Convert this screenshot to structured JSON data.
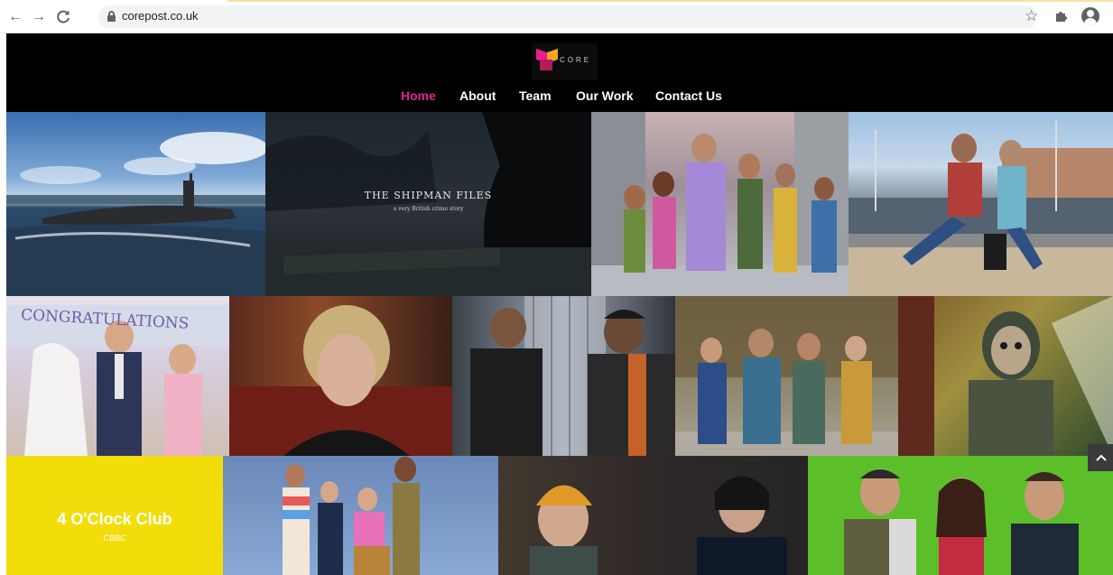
{
  "browser": {
    "url": "corepost.co.uk",
    "back_icon": "←",
    "forward_icon": "→",
    "reload_icon": "C"
  },
  "site": {
    "logo_text": "CORE",
    "nav": [
      {
        "label": "Home"
      },
      {
        "label": "About"
      },
      {
        "label": "Team"
      },
      {
        "label": "Our Work"
      },
      {
        "label": "Contact Us"
      }
    ],
    "accent_color": "#e0258a"
  },
  "tiles": {
    "shipman_title": "THE SHIPMAN FILES",
    "shipman_subtitle": "a very British crime story",
    "wedding_banner": "CONGRATULATIONS",
    "club_title": "4 O'Clock Club",
    "club_channel": "CBBC"
  },
  "scroll_top_icon": "^"
}
